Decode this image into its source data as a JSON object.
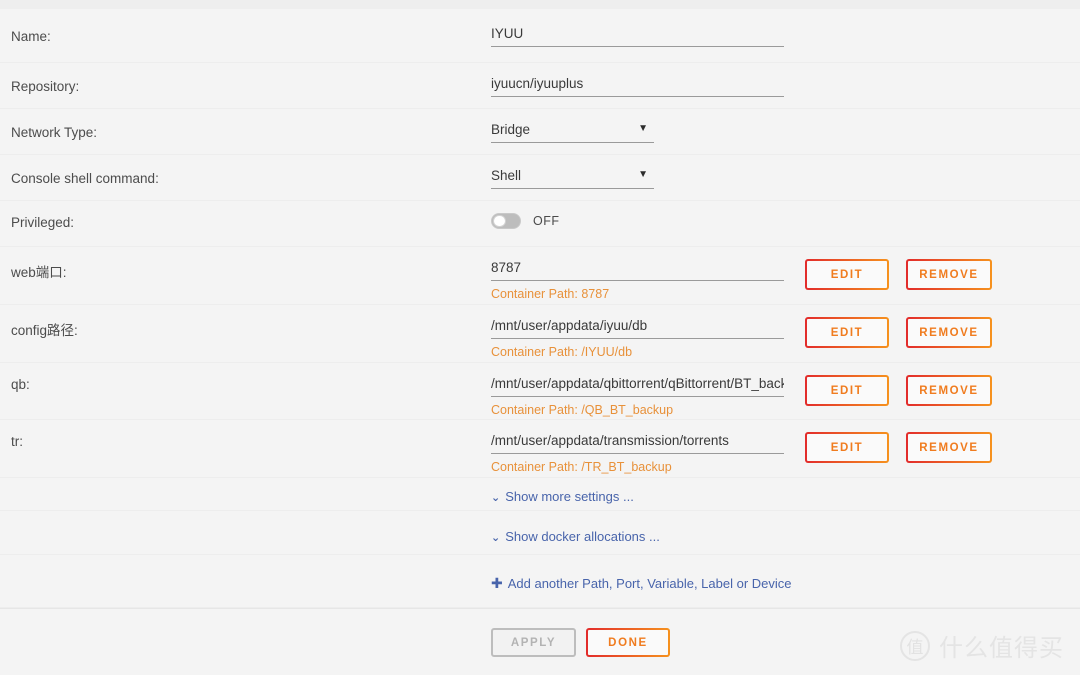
{
  "form": {
    "fields": [
      {
        "label": "Name:",
        "type": "text",
        "value": "IYUU"
      },
      {
        "label": "Repository:",
        "type": "text",
        "value": "iyuucn/iyuuplus"
      },
      {
        "label": "Network Type:",
        "type": "select",
        "value": "Bridge"
      },
      {
        "label": "Console shell command:",
        "type": "select",
        "value": "Shell"
      },
      {
        "label": "Privileged:",
        "type": "toggle",
        "value": "OFF"
      }
    ],
    "mappings": [
      {
        "label": "web端口:",
        "value": "8787",
        "container_path": "Container Path: 8787",
        "edit_label": "EDIT",
        "remove_label": "REMOVE"
      },
      {
        "label": "config路径:",
        "value": "/mnt/user/appdata/iyuu/db",
        "container_path": "Container Path: /IYUU/db",
        "edit_label": "EDIT",
        "remove_label": "REMOVE"
      },
      {
        "label": "qb:",
        "value": "/mnt/user/appdata/qbittorrent/qBittorrent/BT_backup",
        "container_path": "Container Path: /QB_BT_backup",
        "edit_label": "EDIT",
        "remove_label": "REMOVE"
      },
      {
        "label": "tr:",
        "value": "/mnt/user/appdata/transmission/torrents",
        "container_path": "Container Path: /TR_BT_backup",
        "edit_label": "EDIT",
        "remove_label": "REMOVE"
      }
    ],
    "links": [
      {
        "icon": "chevron-down-icon",
        "glyph": "⌄",
        "text": "Show more settings ..."
      },
      {
        "icon": "chevron-down-icon",
        "glyph": "⌄",
        "text": "Show docker allocations ..."
      },
      {
        "icon": "plus-icon",
        "glyph": "✚",
        "text": "Add another Path, Port, Variable, Label or Device"
      }
    ]
  },
  "footer": {
    "apply_label": "APPLY",
    "done_label": "DONE"
  },
  "watermark": {
    "mark": "值",
    "text": "什么值得买"
  },
  "colors": {
    "background": "#f4f4f4",
    "accent_orange": "#f07c1f",
    "accent_red": "#e22b2b",
    "container_path": "#e8913a",
    "link": "#4864ab",
    "label": "#4c4c4c",
    "input_underline": "#9a9a9a",
    "disabled": "#b3b3b3"
  }
}
